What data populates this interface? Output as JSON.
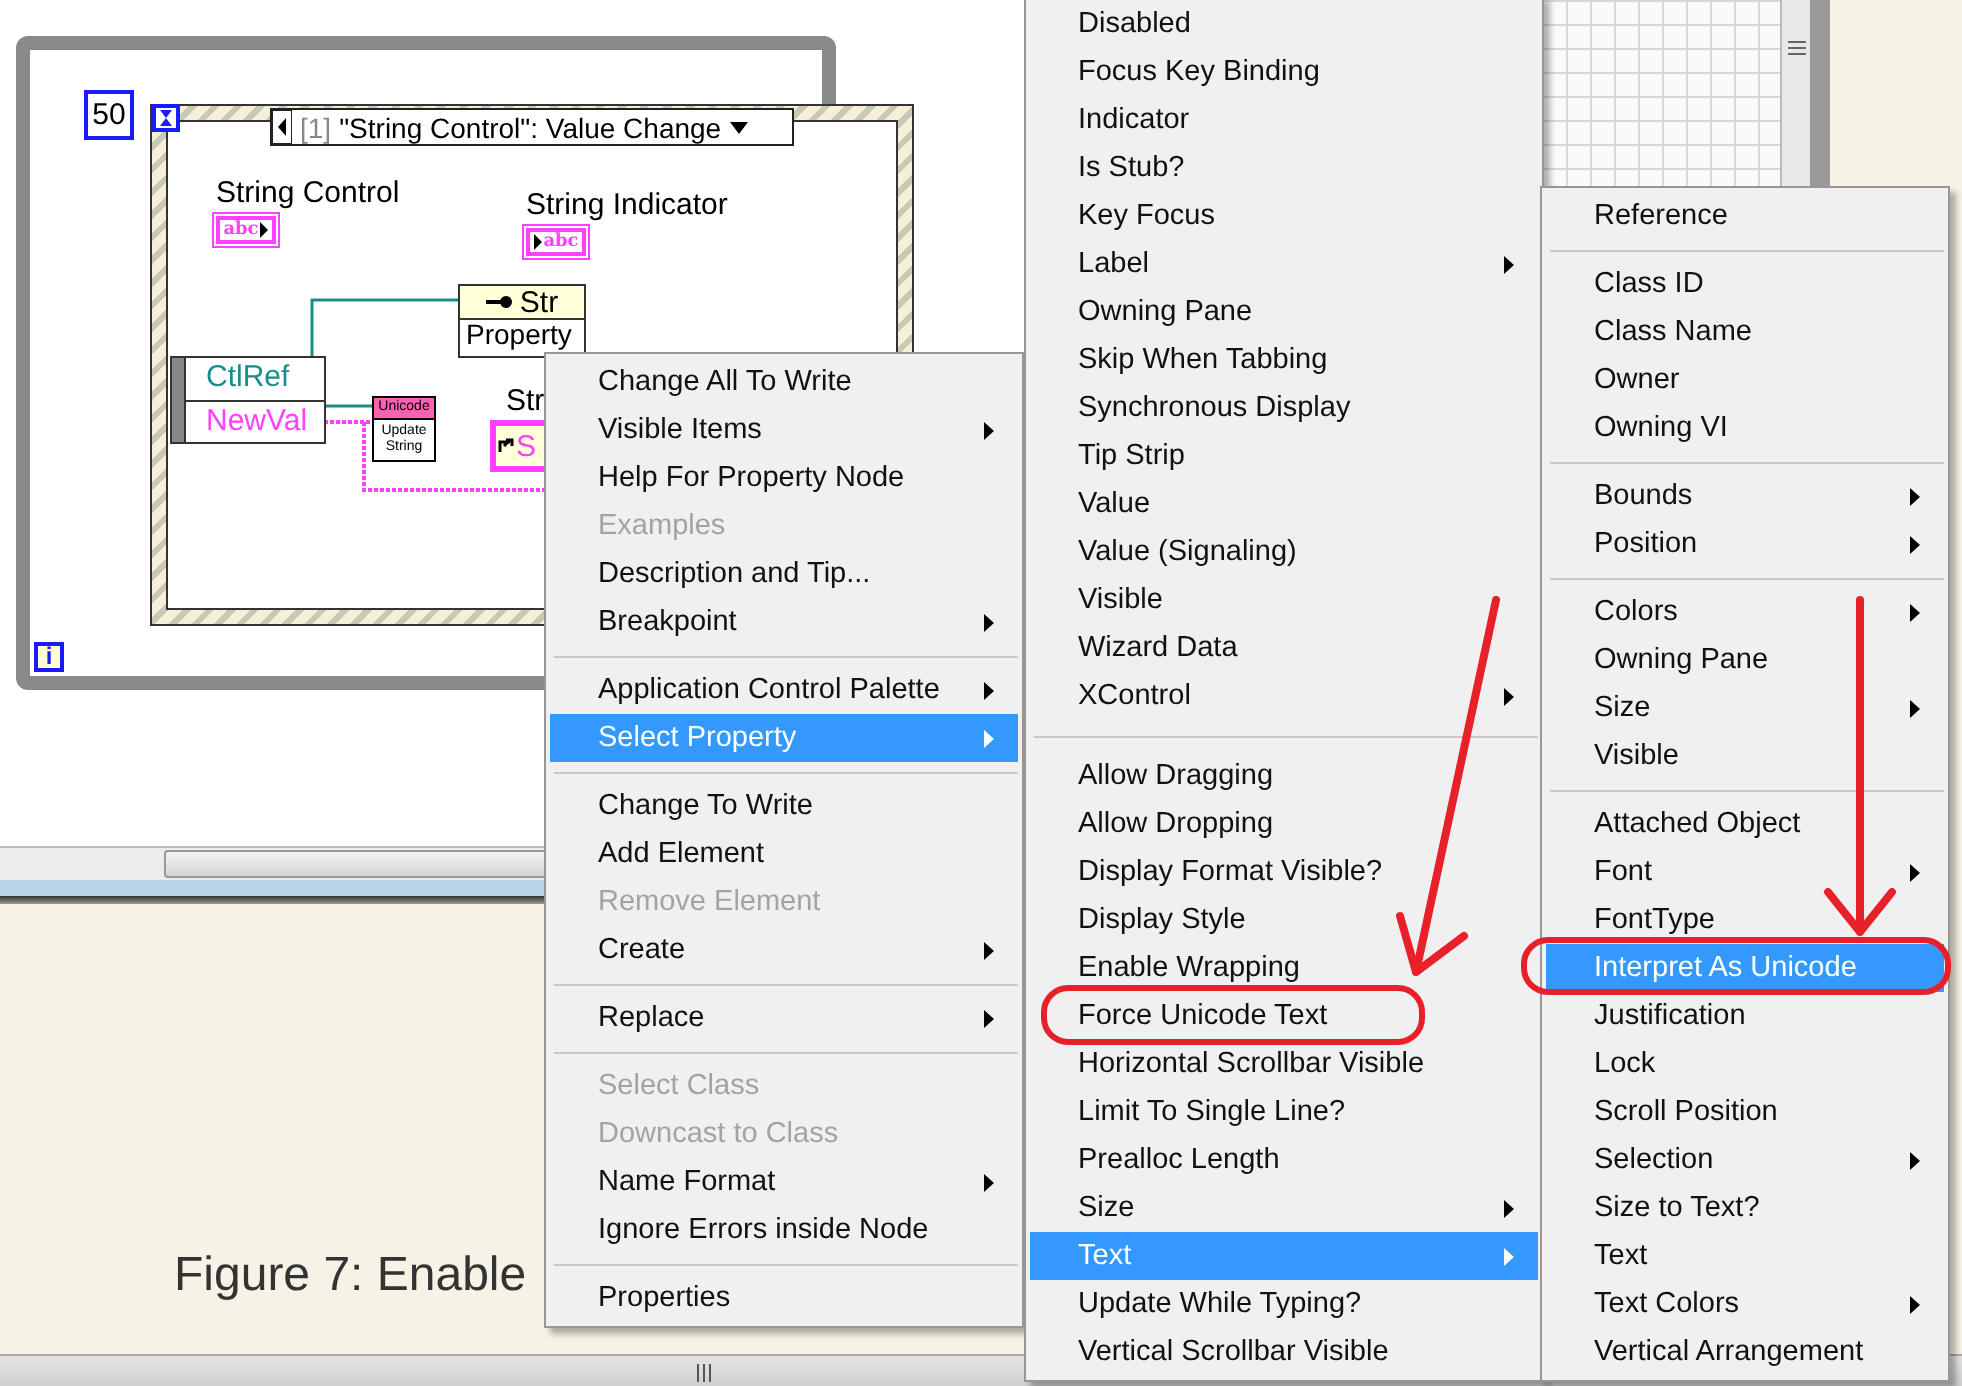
{
  "diagram": {
    "loop_count": "50",
    "iteration_terminal": "i",
    "case_selector": {
      "index": "[1]",
      "label": "\"String Control\": Value Change"
    },
    "controls": [
      {
        "label": "String Control",
        "terminal": "abc",
        "kind": "control"
      },
      {
        "label": "String Indicator",
        "terminal": "abc",
        "kind": "indicator"
      }
    ],
    "event_data": [
      {
        "label": "CtlRef",
        "kind": "reference"
      },
      {
        "label": "NewVal",
        "kind": "string"
      }
    ],
    "property_node": {
      "class": "Str",
      "property": "Property"
    },
    "subvi": {
      "header": "Unicode",
      "body": "Update String"
    },
    "local_terminal": {
      "label": "Str",
      "text": "S"
    }
  },
  "menus": [
    {
      "sections": [
        {
          "items": [
            {
              "label": "Change All To Write",
              "submenu": false,
              "disabled": false,
              "selected": false
            },
            {
              "label": "Visible Items",
              "submenu": true,
              "disabled": false,
              "selected": false
            },
            {
              "label": "Help For Property Node",
              "submenu": false,
              "disabled": false,
              "selected": false
            },
            {
              "label": "Examples",
              "submenu": false,
              "disabled": true,
              "selected": false
            },
            {
              "label": "Description and Tip...",
              "submenu": false,
              "disabled": false,
              "selected": false
            },
            {
              "label": "Breakpoint",
              "submenu": true,
              "disabled": false,
              "selected": false
            }
          ]
        },
        {
          "items": [
            {
              "label": "Application Control Palette",
              "submenu": true,
              "disabled": false,
              "selected": false
            },
            {
              "label": "Select Property",
              "submenu": true,
              "disabled": false,
              "selected": true
            }
          ]
        },
        {
          "items": [
            {
              "label": "Change To Write",
              "submenu": false,
              "disabled": false,
              "selected": false
            },
            {
              "label": "Add Element",
              "submenu": false,
              "disabled": false,
              "selected": false
            },
            {
              "label": "Remove Element",
              "submenu": false,
              "disabled": true,
              "selected": false
            },
            {
              "label": "Create",
              "submenu": true,
              "disabled": false,
              "selected": false
            }
          ]
        },
        {
          "items": [
            {
              "label": "Replace",
              "submenu": true,
              "disabled": false,
              "selected": false
            }
          ]
        },
        {
          "items": [
            {
              "label": "Select Class",
              "submenu": false,
              "disabled": true,
              "selected": false
            },
            {
              "label": "Downcast to Class",
              "submenu": false,
              "disabled": true,
              "selected": false
            },
            {
              "label": "Name Format",
              "submenu": true,
              "disabled": false,
              "selected": false
            },
            {
              "label": "Ignore Errors inside Node",
              "submenu": false,
              "disabled": false,
              "selected": false
            }
          ]
        },
        {
          "items": [
            {
              "label": "Properties",
              "submenu": false,
              "disabled": false,
              "selected": false
            }
          ]
        }
      ]
    },
    {
      "sections": [
        {
          "items": [
            {
              "label": "Disabled",
              "submenu": false,
              "disabled": false,
              "selected": false
            },
            {
              "label": "Focus Key Binding",
              "submenu": false,
              "disabled": false,
              "selected": false
            },
            {
              "label": "Indicator",
              "submenu": false,
              "disabled": false,
              "selected": false
            },
            {
              "label": "Is Stub?",
              "submenu": false,
              "disabled": false,
              "selected": false
            },
            {
              "label": "Key Focus",
              "submenu": false,
              "disabled": false,
              "selected": false
            },
            {
              "label": "Label",
              "submenu": true,
              "disabled": false,
              "selected": false
            },
            {
              "label": "Owning Pane",
              "submenu": false,
              "disabled": false,
              "selected": false
            },
            {
              "label": "Skip When Tabbing",
              "submenu": false,
              "disabled": false,
              "selected": false
            },
            {
              "label": "Synchronous Display",
              "submenu": false,
              "disabled": false,
              "selected": false
            },
            {
              "label": "Tip Strip",
              "submenu": false,
              "disabled": false,
              "selected": false
            },
            {
              "label": "Value",
              "submenu": false,
              "disabled": false,
              "selected": false
            },
            {
              "label": "Value (Signaling)",
              "submenu": false,
              "disabled": false,
              "selected": false
            },
            {
              "label": "Visible",
              "submenu": false,
              "disabled": false,
              "selected": false
            },
            {
              "label": "Wizard Data",
              "submenu": false,
              "disabled": false,
              "selected": false
            },
            {
              "label": "XControl",
              "submenu": true,
              "disabled": false,
              "selected": false
            }
          ]
        },
        {
          "items": [
            {
              "label": "Allow Dragging",
              "submenu": false,
              "disabled": false,
              "selected": false
            },
            {
              "label": "Allow Dropping",
              "submenu": false,
              "disabled": false,
              "selected": false
            },
            {
              "label": "Display Format Visible?",
              "submenu": false,
              "disabled": false,
              "selected": false
            },
            {
              "label": "Display Style",
              "submenu": false,
              "disabled": false,
              "selected": false
            },
            {
              "label": "Enable Wrapping",
              "submenu": false,
              "disabled": false,
              "selected": false
            },
            {
              "label": "Force Unicode Text",
              "submenu": false,
              "disabled": false,
              "selected": false
            },
            {
              "label": "Horizontal Scrollbar Visible",
              "submenu": false,
              "disabled": false,
              "selected": false
            },
            {
              "label": "Limit To Single Line?",
              "submenu": false,
              "disabled": false,
              "selected": false
            },
            {
              "label": "Prealloc Length",
              "submenu": false,
              "disabled": false,
              "selected": false
            },
            {
              "label": "Size",
              "submenu": true,
              "disabled": false,
              "selected": false
            },
            {
              "label": "Text",
              "submenu": true,
              "disabled": false,
              "selected": true
            },
            {
              "label": "Update While Typing?",
              "submenu": false,
              "disabled": false,
              "selected": false
            },
            {
              "label": "Vertical Scrollbar Visible",
              "submenu": false,
              "disabled": false,
              "selected": false
            }
          ]
        }
      ]
    },
    {
      "sections": [
        {
          "items": [
            {
              "label": "Reference",
              "submenu": false,
              "disabled": false,
              "selected": false
            }
          ]
        },
        {
          "items": [
            {
              "label": "Class ID",
              "submenu": false,
              "disabled": false,
              "selected": false
            },
            {
              "label": "Class Name",
              "submenu": false,
              "disabled": false,
              "selected": false
            },
            {
              "label": "Owner",
              "submenu": false,
              "disabled": false,
              "selected": false
            },
            {
              "label": "Owning VI",
              "submenu": false,
              "disabled": false,
              "selected": false
            }
          ]
        },
        {
          "items": [
            {
              "label": "Bounds",
              "submenu": true,
              "disabled": false,
              "selected": false
            },
            {
              "label": "Position",
              "submenu": true,
              "disabled": false,
              "selected": false
            }
          ]
        },
        {
          "items": [
            {
              "label": "Colors",
              "submenu": true,
              "disabled": false,
              "selected": false
            },
            {
              "label": "Owning Pane",
              "submenu": false,
              "disabled": false,
              "selected": false
            },
            {
              "label": "Size",
              "submenu": true,
              "disabled": false,
              "selected": false
            },
            {
              "label": "Visible",
              "submenu": false,
              "disabled": false,
              "selected": false
            }
          ]
        },
        {
          "items": [
            {
              "label": "Attached Object",
              "submenu": false,
              "disabled": false,
              "selected": false
            },
            {
              "label": "Font",
              "submenu": true,
              "disabled": false,
              "selected": false
            },
            {
              "label": "FontType",
              "submenu": false,
              "disabled": false,
              "selected": false
            },
            {
              "label": "Interpret As Unicode",
              "submenu": false,
              "disabled": false,
              "selected": true
            },
            {
              "label": "Justification",
              "submenu": false,
              "disabled": false,
              "selected": false
            },
            {
              "label": "Lock",
              "submenu": false,
              "disabled": false,
              "selected": false
            },
            {
              "label": "Scroll Position",
              "submenu": false,
              "disabled": false,
              "selected": false
            },
            {
              "label": "Selection",
              "submenu": true,
              "disabled": false,
              "selected": false
            },
            {
              "label": "Size to Text?",
              "submenu": false,
              "disabled": false,
              "selected": false
            },
            {
              "label": "Text",
              "submenu": false,
              "disabled": false,
              "selected": false
            },
            {
              "label": "Text Colors",
              "submenu": true,
              "disabled": false,
              "selected": false
            },
            {
              "label": "Vertical Arrangement",
              "submenu": false,
              "disabled": false,
              "selected": false
            }
          ]
        }
      ]
    }
  ],
  "caption": {
    "text": "Figure 7: Enable"
  }
}
